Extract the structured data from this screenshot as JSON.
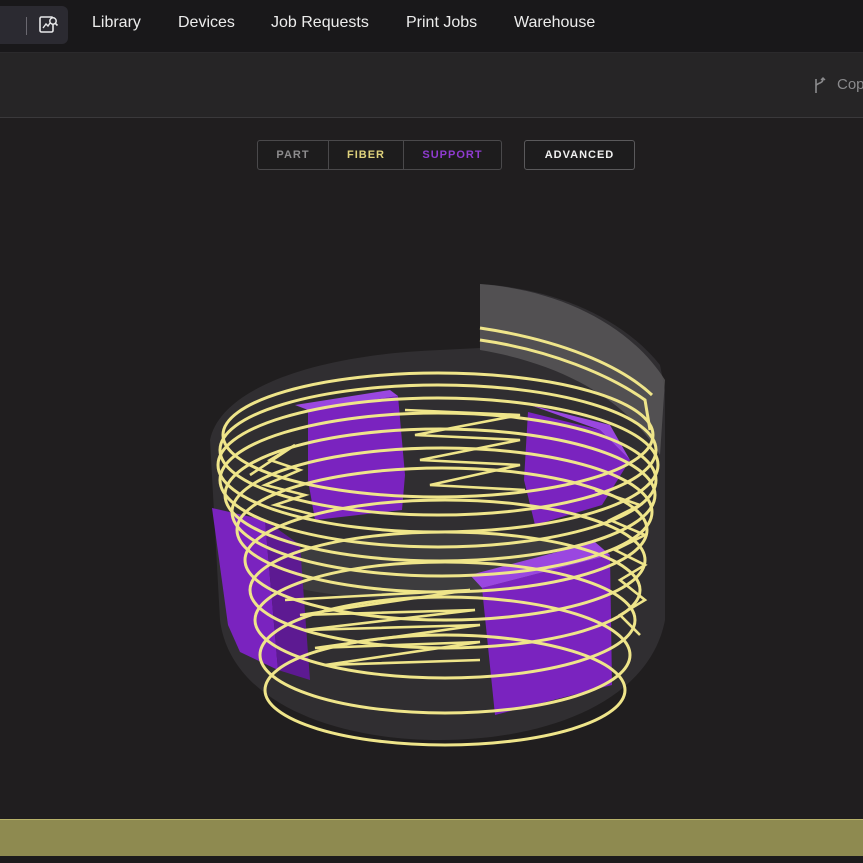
{
  "nav": {
    "items": [
      "Library",
      "Devices",
      "Job Requests",
      "Print Jobs",
      "Warehouse"
    ]
  },
  "toolbar": {
    "copy_label": "Cop",
    "copy_icon": "fork-icon",
    "library_icon": "library-icon"
  },
  "view_modes": {
    "part": "PART",
    "fiber": "FIBER",
    "support": "SUPPORT",
    "advanced": "ADVANCED"
  },
  "colors": {
    "fiber": "#efe58a",
    "support": "#8a2fd1",
    "part": "#5a595b",
    "bottom_bar": "#8e8a50"
  }
}
